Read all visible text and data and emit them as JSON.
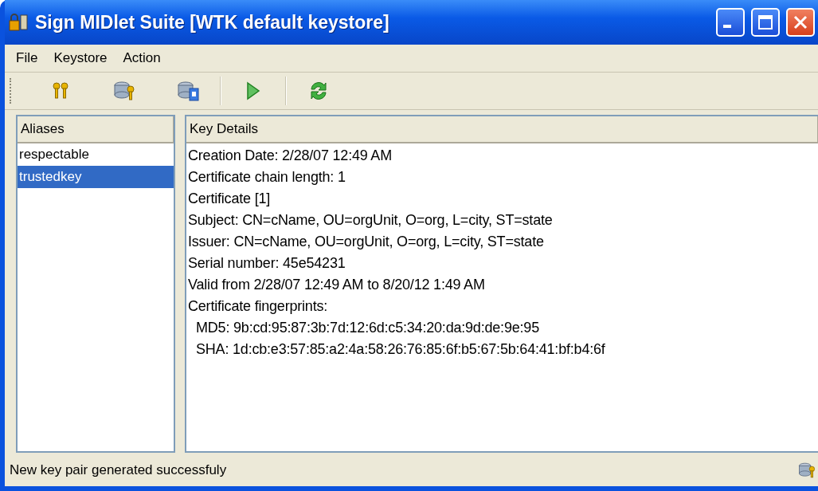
{
  "window": {
    "title": "Sign MIDlet Suite [WTK default keystore]"
  },
  "menu": [
    "File",
    "Keystore",
    "Action"
  ],
  "aliases": {
    "header": "Aliases",
    "items": [
      {
        "label": "respectable",
        "selected": false
      },
      {
        "label": "trustedkey",
        "selected": true
      }
    ]
  },
  "details": {
    "header": "Key Details",
    "lines": [
      {
        "kind": "line",
        "text": "Creation Date: 2/28/07 12:49 AM"
      },
      {
        "kind": "line",
        "text": "Certificate chain length: 1"
      },
      {
        "kind": "line",
        "text": "Certificate [1]"
      },
      {
        "kind": "line",
        "text": "Subject: CN=cName, OU=orgUnit, O=org, L=city, ST=state"
      },
      {
        "kind": "line",
        "text": "Issuer: CN=cName, OU=orgUnit, O=org, L=city, ST=state"
      },
      {
        "kind": "line",
        "text": "Serial number: 45e54231"
      },
      {
        "kind": "line",
        "text": "Valid from 2/28/07 12:49 AM to 8/20/12 1:49 AM"
      },
      {
        "kind": "line",
        "text": "Certificate fingerprints:"
      },
      {
        "kind": "fingerprint",
        "text": "MD5: 9b:cd:95:87:3b:7d:12:6d:c5:34:20:da:9d:de:9e:95"
      },
      {
        "kind": "fingerprint",
        "text": "SHA: 1d:cb:e3:57:85:a2:4a:58:26:76:85:6f:b5:67:5b:64:41:bf:b4:6f"
      }
    ]
  },
  "status_bar": {
    "text": "New key pair generated successfuly"
  }
}
